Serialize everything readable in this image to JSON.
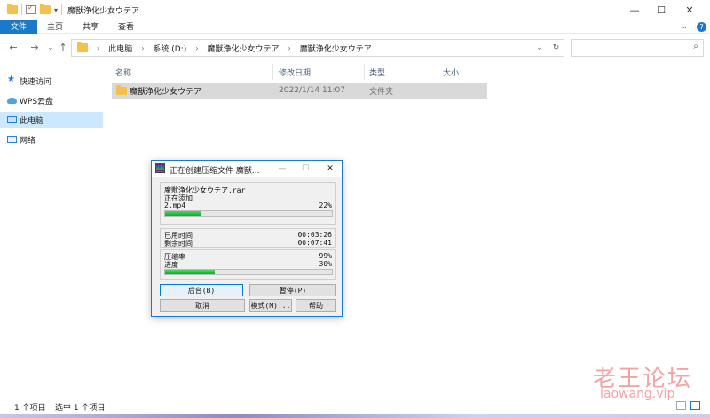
{
  "window": {
    "title": "魔獣浄化少女ウテア",
    "minimize": "—",
    "maximize": "☐",
    "close": "✕"
  },
  "ribbon": {
    "tabs": [
      "文件",
      "主页",
      "共享",
      "查看"
    ],
    "expand": "⌄",
    "help": "?"
  },
  "nav": {
    "back": "←",
    "forward": "→",
    "recent": "⌄",
    "up": "↑",
    "path": [
      "此电脑",
      "系统 (D:)",
      "魔獣浄化少女ウテア",
      "魔獣浄化少女ウテア"
    ],
    "path_sep": "›",
    "dropdown": "⌄",
    "refresh": "↻",
    "search_icon": "⌕"
  },
  "sidebar": {
    "items": [
      {
        "label": "快速访问",
        "icon": "star-icon"
      },
      {
        "label": "WPS云盘",
        "icon": "cloud-icon"
      },
      {
        "label": "此电脑",
        "icon": "computer-icon"
      },
      {
        "label": "网络",
        "icon": "network-icon"
      }
    ]
  },
  "list": {
    "columns": [
      "名称",
      "修改日期",
      "类型",
      "大小"
    ],
    "rows": [
      {
        "name": "魔獣浄化少女ウテア",
        "date": "2022/1/14 11:07",
        "type": "文件夹",
        "size": ""
      }
    ]
  },
  "status": {
    "count": "1 个项目",
    "selected": "选中 1 个项目"
  },
  "watermark": {
    "cn": "老王论坛",
    "en": "laowang.vip"
  },
  "dialog": {
    "title": "正在创建压缩文件 魔獣...",
    "archive": "魔獣浄化少女ウテア.rar",
    "adding_label": "正在添加",
    "file": "2.mp4",
    "file_percent": "22%",
    "file_progress": 0.22,
    "elapsed_label": "已用时间",
    "elapsed": "00:03:26",
    "remaining_label": "剩余时间",
    "remaining": "00:07:41",
    "ratio_label": "压缩率",
    "ratio": "99%",
    "progress_label": "进度",
    "progress": "30%",
    "total_progress": 0.3,
    "buttons": {
      "background": "后台(B)",
      "pause": "暂停(P)",
      "cancel": "取消",
      "mode": "模式(M)...",
      "help": "帮助"
    }
  },
  "colors": {
    "accent": "#1979ca",
    "selection": "#cce8ff",
    "row_selected": "#d9d9d9",
    "progress": "#06b025",
    "folder": "#f4c24c"
  }
}
